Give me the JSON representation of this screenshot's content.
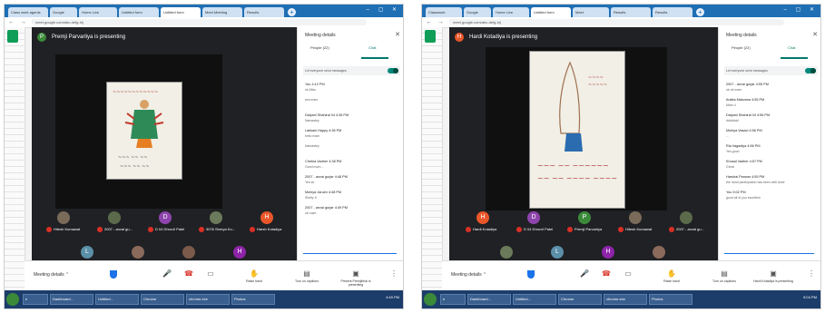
{
  "left": {
    "tabs": [
      "Class work agents",
      "Google",
      "Home Live",
      "Untitled form",
      "Untitled form",
      "Meet Meeting",
      "Results"
    ],
    "url": "meet.google.com/abc-defg-hij",
    "presenter": {
      "initial": "P",
      "text": "Premji Parvarliya is presenting",
      "color": "#3b8a3a"
    },
    "participants_row1": [
      {
        "name": "Hitesh Kumawat",
        "initial": "",
        "color": "#7a6a5a"
      },
      {
        "name": "2007 - anvai gu...",
        "initial": "",
        "color": "#5a6a4a"
      },
      {
        "name": "D 04 Dhruvil Patel",
        "initial": "D",
        "color": "#8e44ad"
      },
      {
        "name": "3076 Shreya Ku...",
        "initial": "",
        "color": "#6a7a5a"
      },
      {
        "name": "Harsh Kotadiya",
        "initial": "H",
        "color": "#e8572a"
      }
    ],
    "participants_row2": [
      {
        "name": "Lakkani Happy",
        "initial": "L",
        "color": "#5b8fa8"
      },
      {
        "name": "Khushi Vadher",
        "initial": "",
        "color": "#8a6a5a"
      },
      {
        "name": "Abhi Prajapati",
        "initial": "",
        "color": "#7a5a4a"
      },
      {
        "name": "D 04 Utkarsh D...",
        "initial": "H",
        "color": "#8e24aa"
      }
    ],
    "controls": {
      "meeting_details": "Meeting details",
      "raise_hand": "Raise hand",
      "turn_on_captions": "Turn on captions",
      "present_now": "Present Premjibhai is presenting"
    },
    "panel": {
      "title": "Meeting details",
      "tab_people": "People (22)",
      "tab_chat": "Chat",
      "toggle_label": "Let everyone send messages",
      "messages": [
        {
          "name": "You  4:12 PM",
          "text": "ok Miss"
        },
        {
          "name": "",
          "text": "yes mam"
        },
        {
          "name": "Dalyani Shahiral 04  4:35 PM",
          "text": "Namastey"
        },
        {
          "name": "Lakkani Happy  4:36 PM",
          "text": "hello mam"
        },
        {
          "name": "",
          "text": "Namastey"
        },
        {
          "name": "Chetna Vadher  4:38 PM",
          "text": "Good morn..."
        },
        {
          "name": "2007 - anvai gurjar  4:48 PM",
          "text": "Yes sir"
        },
        {
          "name": "Mohiya Jaruen  4:48 PM",
          "text": "Shelly Ji"
        },
        {
          "name": "2007 - anvai gurjar  4:49 PM",
          "text": "ok mam"
        }
      ]
    }
  },
  "right": {
    "tabs": [
      "Classwork",
      "Google",
      "Home Live",
      "Untitled form",
      "Meet",
      "Results",
      "Results"
    ],
    "url": "meet.google.com/abc-defg-hij",
    "presenter": {
      "initial": "H",
      "text": "Hardi Kotadiya is presenting",
      "color": "#e8572a"
    },
    "participants_row1": [
      {
        "name": "Hardi Kotadiya",
        "initial": "H",
        "color": "#e8572a"
      },
      {
        "name": "D 04 Dhruvil Patel",
        "initial": "D",
        "color": "#8e44ad"
      },
      {
        "name": "Premji Parvarliya",
        "initial": "P",
        "color": "#3b8a3a"
      },
      {
        "name": "Hitesh Kumawat",
        "initial": "",
        "color": "#7a6a5a"
      },
      {
        "name": "2007 - anvai gu...",
        "initial": "",
        "color": "#5a6a4a"
      }
    ],
    "participants_row2": [
      {
        "name": "3076 Shreya Ku...",
        "initial": "",
        "color": "#6a7a5a"
      },
      {
        "name": "Lakkani Happy",
        "initial": "L",
        "color": "#5b8fa8"
      },
      {
        "name": "D 04 Utkarsh D...",
        "initial": "H",
        "color": "#8e24aa"
      },
      {
        "name": "Khushi Vadher",
        "initial": "",
        "color": "#8a6a5a"
      }
    ],
    "controls": {
      "meeting_details": "Meeting details",
      "raise_hand": "Raise hand",
      "turn_on_captions": "Turn on captions",
      "present_now": "Hardi Kotadiya is presenting"
    },
    "panel": {
      "title": "Meeting details",
      "tab_people": "People (22)",
      "tab_chat": "Chat",
      "toggle_label": "Let everyone send messages",
      "messages": [
        {
          "name": "2007 - anvai gurjar  4:55 PM",
          "text": "ok ok mam"
        },
        {
          "name": "Ankita Makvana  4:55 PM",
          "text": "Mam 4"
        },
        {
          "name": "Dalyani Shahiral 04  4:56 PM",
          "text": "ddddddd"
        },
        {
          "name": "Mohiya Vasavi  4:56 PM",
          "text": "..."
        },
        {
          "name": "Ria Vagadiya  4:56 PM",
          "text": "Yes good"
        },
        {
          "name": "Khusal Vadher  4:57 PM",
          "text": "Great"
        },
        {
          "name": "Harshal Panwar  4:59 PM",
          "text": "the hand participation has been well done"
        },
        {
          "name": "You  5:02 PM",
          "text": "good all of you excellent"
        }
      ]
    }
  },
  "taskbar": {
    "left_items": [
      "e",
      "Dashboard...",
      "Untitled...",
      "Chrome",
      "chrome.exe",
      "Photos"
    ],
    "right_items": [
      "e",
      "Dashboard...",
      "Untitled...",
      "Chrome",
      "chrome.exe",
      "Photos"
    ],
    "clock_left": "4:49 PM",
    "clock_right": "5:04 PM"
  }
}
